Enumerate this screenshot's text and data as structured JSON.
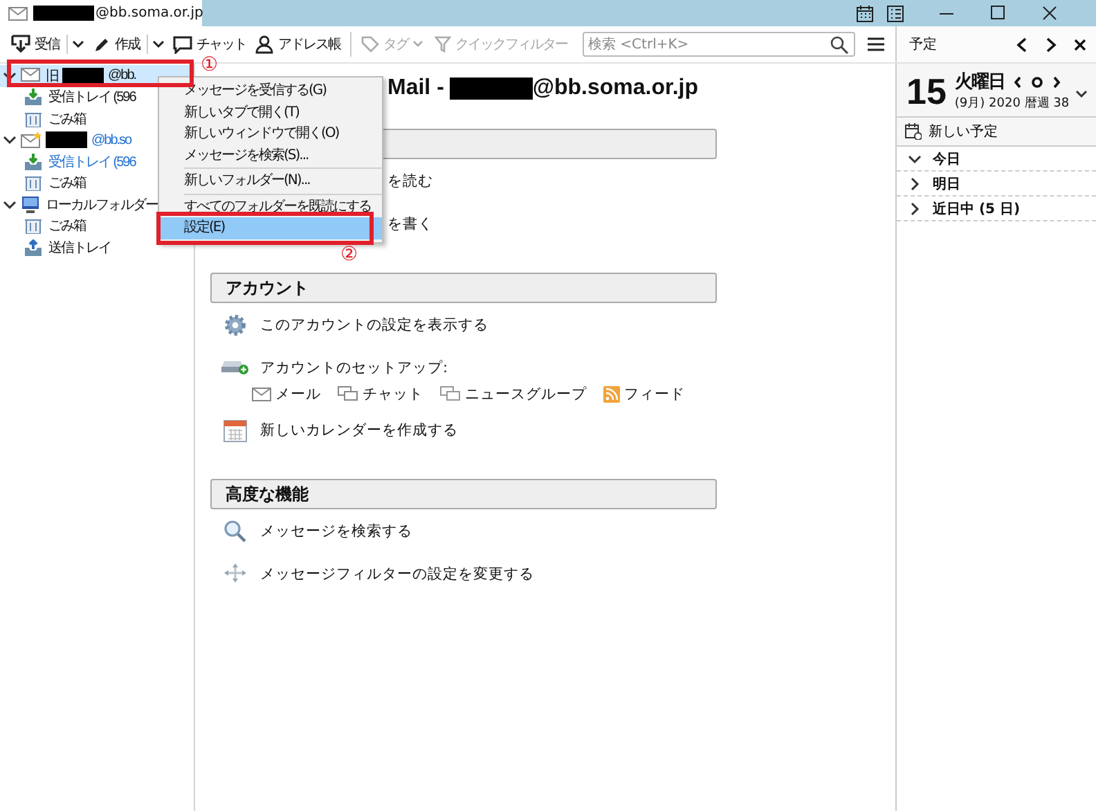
{
  "window": {
    "tab": {
      "redacted": true,
      "label": "@bb.soma.or.jp"
    }
  },
  "toolbar": {
    "buttons": [
      {
        "kind": "download",
        "label": "受信",
        "dropdown": true,
        "disabled": false
      },
      {
        "kind": "pencil",
        "label": "作成",
        "dropdown": true,
        "disabled": false
      },
      {
        "kind": "chat",
        "label": "チャット",
        "dropdown": false,
        "disabled": false
      },
      {
        "kind": "person",
        "label": "アドレス帳",
        "dropdown": false,
        "disabled": false
      },
      {
        "kind": "tag",
        "label": "タグ",
        "dropdown": true,
        "disabled": true
      },
      {
        "kind": "funnel",
        "label": "クイックフィルター",
        "dropdown": false,
        "disabled": true
      }
    ],
    "search": {
      "placeholder": "検索 <Ctrl+K>"
    }
  },
  "folders": [
    {
      "kind": "account",
      "label_start": "旧",
      "redacted": true,
      "label": "@bb.",
      "expanded": true,
      "selected": true,
      "unread": false,
      "children": [
        {
          "kind": "inbox",
          "label": "受信トレイ (596",
          "selected": false,
          "unread": false
        },
        {
          "kind": "trash",
          "label": "ごみ箱",
          "selected": false,
          "unread": false
        }
      ]
    },
    {
      "kind": "account-new",
      "redacted": true,
      "label": "@bb.so",
      "expanded": true,
      "selected": false,
      "unread": true,
      "children": [
        {
          "kind": "inbox",
          "label": "受信トレイ (596",
          "selected": false,
          "unread": true
        },
        {
          "kind": "trash",
          "label": "ごみ箱",
          "selected": false,
          "unread": false
        }
      ]
    },
    {
      "kind": "local",
      "label": "ローカルフォルダー",
      "expanded": true,
      "selected": false,
      "unread": false,
      "children": [
        {
          "kind": "trash",
          "label": "ごみ箱",
          "selected": false,
          "unread": false
        },
        {
          "kind": "outbox",
          "label": "送信トレイ",
          "selected": false,
          "unread": false
        }
      ]
    }
  ],
  "context_menu": {
    "items": [
      {
        "kind": "item",
        "label": "メッセージを受信する(G)",
        "selected": false
      },
      {
        "kind": "item",
        "label": "新しいタブで開く(T)",
        "selected": false
      },
      {
        "kind": "item",
        "label": "新しいウィンドウで開く(O)",
        "selected": false
      },
      {
        "kind": "item",
        "label": "メッセージを検索(S)...",
        "selected": false
      },
      {
        "kind": "separator"
      },
      {
        "kind": "item",
        "label": "新しいフォルダー(N)...",
        "selected": false
      },
      {
        "kind": "separator"
      },
      {
        "kind": "item",
        "label": "すべてのフォルダーを既読にする",
        "selected": false
      },
      {
        "kind": "item",
        "label": "設定(E)",
        "selected": true
      }
    ]
  },
  "annotations": [
    {
      "label": "①"
    },
    {
      "label": "②"
    }
  ],
  "main": {
    "title": "Mail -",
    "title_redacted": true,
    "title_end": "@bb.soma.or.jp",
    "sections": [
      {
        "rows": [
          {
            "label": "を読む"
          },
          {
            "label": "を書く"
          }
        ]
      },
      {
        "heading": "アカウント",
        "rows": [
          {
            "kind": "gear",
            "label": "このアカウントの設定を表示する"
          },
          {
            "kind": "setup",
            "label": "アカウントのセットアップ:",
            "links": [
              {
                "kind": "mail",
                "label": "メール"
              },
              {
                "kind": "chat",
                "label": "チャット"
              },
              {
                "kind": "news",
                "label": "ニュースグループ"
              },
              {
                "kind": "feed",
                "label": "フィード"
              }
            ]
          },
          {
            "kind": "calendar",
            "label": "新しいカレンダーを作成する"
          }
        ]
      },
      {
        "heading": "高度な機能",
        "rows": [
          {
            "kind": "search",
            "label": "メッセージを検索する"
          },
          {
            "kind": "filter",
            "label": "メッセージフィルターの設定を変更する"
          }
        ]
      }
    ]
  },
  "today_pane": {
    "title": "予定",
    "day": "15",
    "weekday": "火曜日",
    "subtitle": "(9月) 2020 暦週 38",
    "new_event": "新しい予定",
    "groups": [
      {
        "label": "今日",
        "expanded": true
      },
      {
        "label": "明日",
        "expanded": false
      },
      {
        "label": "近日中 (5 日)",
        "expanded": false
      }
    ]
  }
}
